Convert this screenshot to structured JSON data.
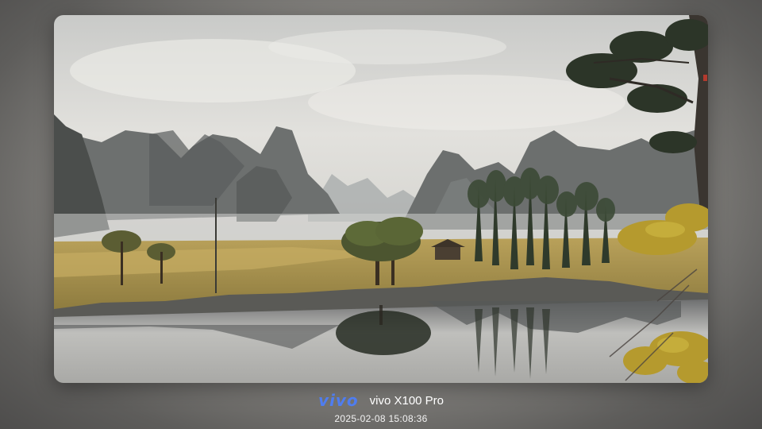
{
  "watermark": {
    "brand": "vivo",
    "device": "vivo X100 Pro",
    "timestamp": "2025-02-08 15:08:36",
    "brand_color": "#4f7df0"
  },
  "photo": {
    "subject": "landscape-painting"
  }
}
